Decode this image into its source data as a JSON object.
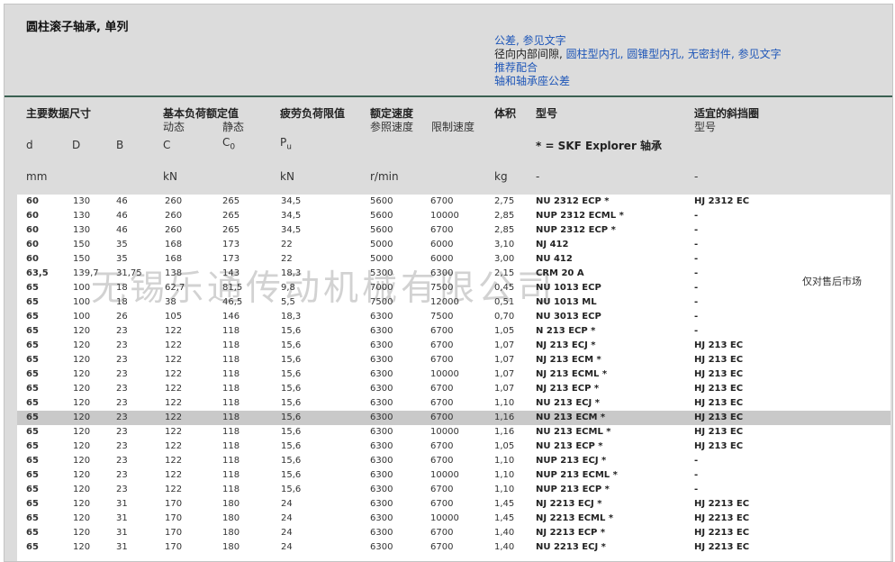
{
  "title": "圆柱滚子轴承, 单列",
  "links": {
    "tolerance": "公差",
    "tolerance_ref": ", 参见文字",
    "clearance_label": "径向内部间隙,",
    "clearance_cyl": "圆柱型内孔",
    "clearance_tap": ", 圆锥型内孔, 无密封件",
    "clearance_ref": ", 参见文字",
    "fits": "推荐配合",
    "shaft_housing": "轴和轴承座公差"
  },
  "headers": {
    "main_dims": "主要数据尺寸",
    "basic_load": "基本负荷额定值",
    "dynamic": "动态",
    "static": "静态",
    "fatigue": "疲劳负荷限值",
    "speed": "额定速度",
    "ref_speed": "参照速度",
    "limit_speed": "限制速度",
    "mass": "体积",
    "designation": "型号",
    "ring": "适宜的斜挡圈",
    "ring_sub": "型号",
    "sym_d": "d",
    "sym_D": "D",
    "sym_B": "B",
    "sym_C": "C",
    "sym_C0": "C",
    "sym_C0_sub": "0",
    "sym_Pu": "P",
    "sym_Pu_sub": "u",
    "explorer": "* = SKF Explorer 轴承",
    "unit_mm": "mm",
    "unit_kN": "kN",
    "unit_kN2": "kN",
    "unit_rpm": "r/min",
    "unit_kg": "kg",
    "unit_dash1": "-",
    "unit_dash2": "-"
  },
  "rows": [
    {
      "d": "60",
      "D": "130",
      "B": "46",
      "C": "260",
      "C0": "265",
      "Pu": "34,5",
      "ref": "5600",
      "lim": "6700",
      "m": "2,75",
      "des": "NU 2312 ECP *",
      "ring": "HJ 2312 EC"
    },
    {
      "d": "60",
      "D": "130",
      "B": "46",
      "C": "260",
      "C0": "265",
      "Pu": "34,5",
      "ref": "5600",
      "lim": "10000",
      "m": "2,85",
      "des": "NUP 2312 ECML *",
      "ring": "-"
    },
    {
      "d": "60",
      "D": "130",
      "B": "46",
      "C": "260",
      "C0": "265",
      "Pu": "34,5",
      "ref": "5600",
      "lim": "6700",
      "m": "2,85",
      "des": "NUP 2312 ECP *",
      "ring": "-"
    },
    {
      "d": "60",
      "D": "150",
      "B": "35",
      "C": "168",
      "C0": "173",
      "Pu": "22",
      "ref": "5000",
      "lim": "6000",
      "m": "3,10",
      "des": "NJ 412",
      "ring": "-"
    },
    {
      "d": "60",
      "D": "150",
      "B": "35",
      "C": "168",
      "C0": "173",
      "Pu": "22",
      "ref": "5000",
      "lim": "6000",
      "m": "3,00",
      "des": "NU 412",
      "ring": "-"
    },
    {
      "d": "63,5",
      "D": "139,7",
      "B": "31,75",
      "C": "138",
      "C0": "143",
      "Pu": "18,3",
      "ref": "5300",
      "lim": "6300",
      "m": "2,15",
      "des": "CRM 20 A",
      "ring": "-"
    },
    {
      "d": "65",
      "D": "100",
      "B": "18",
      "C": "62,7",
      "C0": "81,5",
      "Pu": "9,8",
      "ref": "7000",
      "lim": "7500",
      "m": "0,45",
      "des": "NU 1013 ECP",
      "ring": "-"
    },
    {
      "d": "65",
      "D": "100",
      "B": "18",
      "C": "38",
      "C0": "46,5",
      "Pu": "5,5",
      "ref": "7500",
      "lim": "12000",
      "m": "0,51",
      "des": "NU 1013 ML",
      "ring": "-"
    },
    {
      "d": "65",
      "D": "100",
      "B": "26",
      "C": "105",
      "C0": "146",
      "Pu": "18,3",
      "ref": "6300",
      "lim": "7500",
      "m": "0,70",
      "des": "NU 3013 ECP",
      "ring": "-"
    },
    {
      "d": "65",
      "D": "120",
      "B": "23",
      "C": "122",
      "C0": "118",
      "Pu": "15,6",
      "ref": "6300",
      "lim": "6700",
      "m": "1,05",
      "des": "N 213 ECP *",
      "ring": "-"
    },
    {
      "d": "65",
      "D": "120",
      "B": "23",
      "C": "122",
      "C0": "118",
      "Pu": "15,6",
      "ref": "6300",
      "lim": "6700",
      "m": "1,07",
      "des": "NJ 213 ECJ *",
      "ring": "HJ 213 EC"
    },
    {
      "d": "65",
      "D": "120",
      "B": "23",
      "C": "122",
      "C0": "118",
      "Pu": "15,6",
      "ref": "6300",
      "lim": "6700",
      "m": "1,07",
      "des": "NJ 213 ECM *",
      "ring": "HJ 213 EC"
    },
    {
      "d": "65",
      "D": "120",
      "B": "23",
      "C": "122",
      "C0": "118",
      "Pu": "15,6",
      "ref": "6300",
      "lim": "10000",
      "m": "1,07",
      "des": "NJ 213 ECML *",
      "ring": "HJ 213 EC"
    },
    {
      "d": "65",
      "D": "120",
      "B": "23",
      "C": "122",
      "C0": "118",
      "Pu": "15,6",
      "ref": "6300",
      "lim": "6700",
      "m": "1,07",
      "des": "NJ 213 ECP *",
      "ring": "HJ 213 EC"
    },
    {
      "d": "65",
      "D": "120",
      "B": "23",
      "C": "122",
      "C0": "118",
      "Pu": "15,6",
      "ref": "6300",
      "lim": "6700",
      "m": "1,10",
      "des": "NU 213 ECJ *",
      "ring": "HJ 213 EC"
    },
    {
      "d": "65",
      "D": "120",
      "B": "23",
      "C": "122",
      "C0": "118",
      "Pu": "15,6",
      "ref": "6300",
      "lim": "6700",
      "m": "1,16",
      "des": "NU 213 ECM *",
      "ring": "HJ 213 EC"
    },
    {
      "d": "65",
      "D": "120",
      "B": "23",
      "C": "122",
      "C0": "118",
      "Pu": "15,6",
      "ref": "6300",
      "lim": "10000",
      "m": "1,16",
      "des": "NU 213 ECML *",
      "ring": "HJ 213 EC"
    },
    {
      "d": "65",
      "D": "120",
      "B": "23",
      "C": "122",
      "C0": "118",
      "Pu": "15,6",
      "ref": "6300",
      "lim": "6700",
      "m": "1,05",
      "des": "NU 213 ECP *",
      "ring": "HJ 213 EC"
    },
    {
      "d": "65",
      "D": "120",
      "B": "23",
      "C": "122",
      "C0": "118",
      "Pu": "15,6",
      "ref": "6300",
      "lim": "6700",
      "m": "1,10",
      "des": "NUP 213 ECJ *",
      "ring": "-"
    },
    {
      "d": "65",
      "D": "120",
      "B": "23",
      "C": "122",
      "C0": "118",
      "Pu": "15,6",
      "ref": "6300",
      "lim": "10000",
      "m": "1,10",
      "des": "NUP 213 ECML *",
      "ring": "-"
    },
    {
      "d": "65",
      "D": "120",
      "B": "23",
      "C": "122",
      "C0": "118",
      "Pu": "15,6",
      "ref": "6300",
      "lim": "6700",
      "m": "1,10",
      "des": "NUP 213 ECP *",
      "ring": "-"
    },
    {
      "d": "65",
      "D": "120",
      "B": "31",
      "C": "170",
      "C0": "180",
      "Pu": "24",
      "ref": "6300",
      "lim": "6700",
      "m": "1,45",
      "des": "NJ 2213 ECJ *",
      "ring": "HJ 2213 EC"
    },
    {
      "d": "65",
      "D": "120",
      "B": "31",
      "C": "170",
      "C0": "180",
      "Pu": "24",
      "ref": "6300",
      "lim": "10000",
      "m": "1,45",
      "des": "NJ 2213 ECML *",
      "ring": "HJ 2213 EC"
    },
    {
      "d": "65",
      "D": "120",
      "B": "31",
      "C": "170",
      "C0": "180",
      "Pu": "24",
      "ref": "6300",
      "lim": "6700",
      "m": "1,40",
      "des": "NJ 2213 ECP *",
      "ring": "HJ 2213 EC"
    },
    {
      "d": "65",
      "D": "120",
      "B": "31",
      "C": "170",
      "C0": "180",
      "Pu": "24",
      "ref": "6300",
      "lim": "6700",
      "m": "1,40",
      "des": "NU 2213 ECJ *",
      "ring": "HJ 2213 EC"
    }
  ],
  "selected_row": 15,
  "watermark": "无锡乐通传动机械有限公司",
  "watermark_note": "仅对售后市场"
}
